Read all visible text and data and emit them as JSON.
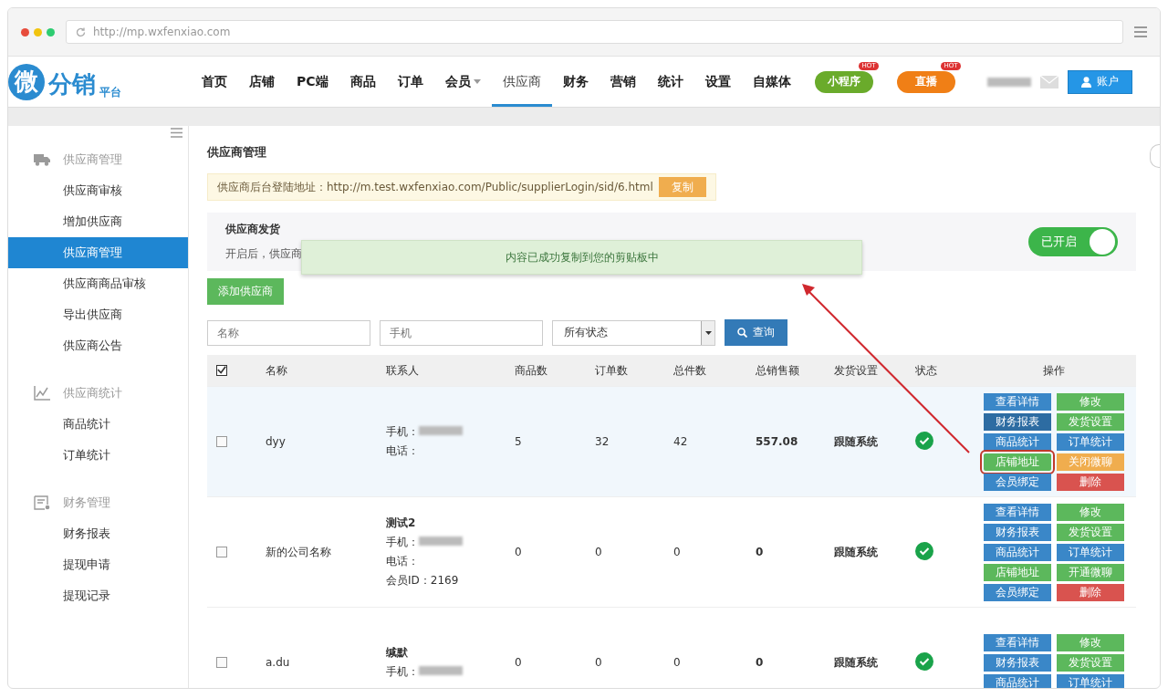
{
  "browser": {
    "url": "http://mp.wxfenxiao.com"
  },
  "header": {
    "logo": {
      "mark": "微",
      "name": "分销",
      "sub": "平台"
    },
    "nav": [
      {
        "label": "首页",
        "selected": false,
        "dropdown": false
      },
      {
        "label": "店铺",
        "selected": false,
        "dropdown": false
      },
      {
        "label": "PC端",
        "selected": false,
        "dropdown": false
      },
      {
        "label": "商品",
        "selected": false,
        "dropdown": false
      },
      {
        "label": "订单",
        "selected": false,
        "dropdown": false
      },
      {
        "label": "会员",
        "selected": false,
        "dropdown": true
      },
      {
        "label": "供应商",
        "selected": true,
        "dropdown": false
      },
      {
        "label": "财务",
        "selected": false,
        "dropdown": false
      },
      {
        "label": "营销",
        "selected": false,
        "dropdown": false
      },
      {
        "label": "统计",
        "selected": false,
        "dropdown": false
      },
      {
        "label": "设置",
        "selected": false,
        "dropdown": false
      },
      {
        "label": "自媒体",
        "selected": false,
        "dropdown": false
      }
    ],
    "pills": [
      {
        "label": "小程序",
        "badge": "HOT",
        "color": "#6aab2b"
      },
      {
        "label": "直播",
        "badge": "HOT",
        "color": "#f07f16"
      }
    ],
    "account_button": "账户"
  },
  "sidebar": [
    {
      "title": "供应商管理",
      "items": [
        {
          "label": "供应商审核",
          "selected": false
        },
        {
          "label": "增加供应商",
          "selected": false
        },
        {
          "label": "供应商管理",
          "selected": true
        },
        {
          "label": "供应商商品审核",
          "selected": false
        },
        {
          "label": "导出供应商",
          "selected": false
        },
        {
          "label": "供应商公告",
          "selected": false
        }
      ]
    },
    {
      "title": "供应商统计",
      "items": [
        {
          "label": "商品统计",
          "selected": false
        },
        {
          "label": "订单统计",
          "selected": false
        }
      ]
    },
    {
      "title": "财务管理",
      "items": [
        {
          "label": "财务报表",
          "selected": false
        },
        {
          "label": "提现申请",
          "selected": false
        },
        {
          "label": "提现记录",
          "selected": false
        }
      ]
    }
  ],
  "page_title": "供应商管理",
  "login_notice": {
    "text": "供应商后台登陆地址：http://m.test.wxfenxiao.com/Public/supplierLogin/sid/6.html",
    "button": "复制"
  },
  "shipping_panel": {
    "title": "供应商发货",
    "description": "开启后，供应商",
    "toggle_label": "已开启",
    "on": true
  },
  "toast": "内容已成功复制到您的剪贴板中",
  "add_button": "添加供应商",
  "filters": {
    "name_placeholder": "名称",
    "phone_placeholder": "手机",
    "status_value": "所有状态",
    "search_button": "查询"
  },
  "table": {
    "header_checked": true,
    "columns": [
      "名称",
      "联系人",
      "商品数",
      "订单数",
      "总件数",
      "总销售额",
      "发货设置",
      "状态",
      "操作"
    ],
    "rows": [
      {
        "checked": false,
        "highlighted": true,
        "name": "dyy",
        "contact": [
          {
            "kind": "label",
            "text": "手机：",
            "blurred": true
          },
          {
            "kind": "label",
            "text": "电话：",
            "blurred": false
          }
        ],
        "goods": "5",
        "orders": "32",
        "items": "42",
        "sales": "557.08",
        "shipping": "跟随系统",
        "status_ok": true,
        "actions": [
          {
            "label": "查看详情",
            "color": "#3a87c8",
            "circled": false
          },
          {
            "label": "修改",
            "color": "#5cb85c",
            "circled": false
          },
          {
            "label": "财务报表",
            "color": "#2d6ca2",
            "circled": false
          },
          {
            "label": "发货设置",
            "color": "#5cb85c",
            "circled": false
          },
          {
            "label": "商品统计",
            "color": "#3a87c8",
            "circled": false
          },
          {
            "label": "订单统计",
            "color": "#3a87c8",
            "circled": false
          },
          {
            "label": "店铺地址",
            "color": "#5cb85c",
            "circled": true
          },
          {
            "label": "关闭微聊",
            "color": "#f0ad4e",
            "circled": false
          },
          {
            "label": "会员绑定",
            "color": "#3a87c8",
            "circled": false
          },
          {
            "label": "删除",
            "color": "#d9534f",
            "circled": false
          }
        ]
      },
      {
        "checked": false,
        "highlighted": false,
        "name": "新的公司名称",
        "contact": [
          {
            "kind": "name",
            "text": "测试2",
            "blurred": false
          },
          {
            "kind": "label",
            "text": "手机：",
            "blurred": true
          },
          {
            "kind": "label",
            "text": "电话：",
            "blurred": false
          },
          {
            "kind": "label",
            "text": "会员ID：2169",
            "blurred": false
          }
        ],
        "goods": "0",
        "orders": "0",
        "items": "0",
        "sales": "0",
        "shipping": "跟随系统",
        "status_ok": true,
        "actions": [
          {
            "label": "查看详情",
            "color": "#3a87c8",
            "circled": false
          },
          {
            "label": "修改",
            "color": "#5cb85c",
            "circled": false
          },
          {
            "label": "财务报表",
            "color": "#3a87c8",
            "circled": false
          },
          {
            "label": "发货设置",
            "color": "#5cb85c",
            "circled": false
          },
          {
            "label": "商品统计",
            "color": "#3a87c8",
            "circled": false
          },
          {
            "label": "订单统计",
            "color": "#3a87c8",
            "circled": false
          },
          {
            "label": "店铺地址",
            "color": "#5cb85c",
            "circled": false
          },
          {
            "label": "开通微聊",
            "color": "#5cb85c",
            "circled": false
          },
          {
            "label": "会员绑定",
            "color": "#3a87c8",
            "circled": false
          },
          {
            "label": "删除",
            "color": "#d9534f",
            "circled": false
          }
        ]
      },
      {
        "checked": false,
        "highlighted": false,
        "name": "a.du",
        "contact": [
          {
            "kind": "name",
            "text": "缄默",
            "blurred": false
          },
          {
            "kind": "label",
            "text": "手机：",
            "blurred": true
          }
        ],
        "goods": "0",
        "orders": "0",
        "items": "0",
        "sales": "0",
        "shipping": "跟随系统",
        "status_ok": true,
        "actions": [
          {
            "label": "查看详情",
            "color": "#3a87c8",
            "circled": false
          },
          {
            "label": "修改",
            "color": "#5cb85c",
            "circled": false
          },
          {
            "label": "财务报表",
            "color": "#3a87c8",
            "circled": false
          },
          {
            "label": "发货设置",
            "color": "#5cb85c",
            "circled": false
          },
          {
            "label": "商品统计",
            "color": "#3a87c8",
            "circled": false
          },
          {
            "label": "订单统计",
            "color": "#3a87c8",
            "circled": false
          }
        ]
      }
    ]
  }
}
